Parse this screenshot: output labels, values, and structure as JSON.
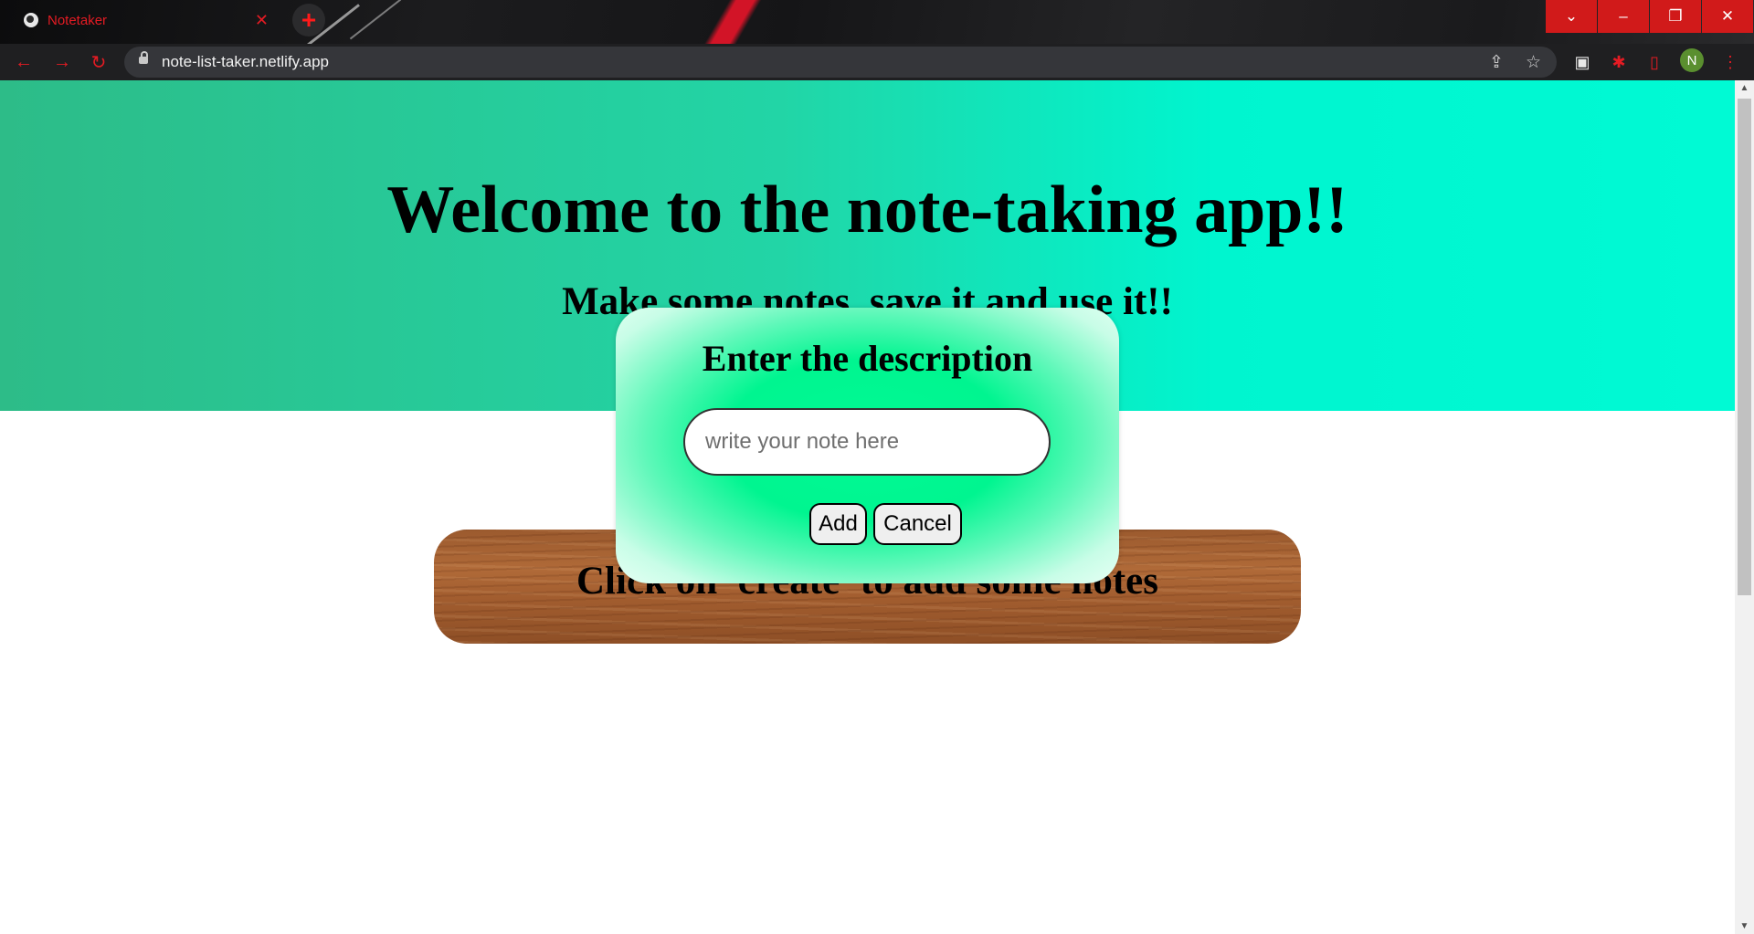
{
  "browser": {
    "tab_title": "Notetaker",
    "tab_close": "✕",
    "new_tab": "+",
    "url": "note-list-taker.netlify.app",
    "profile_initial": "N",
    "window_controls": {
      "tabs_menu": "⌄",
      "minimize": "–",
      "restore": "❐",
      "close": "✕"
    },
    "accent_color": "#e41b23"
  },
  "page": {
    "title": "Welcome to the note-taking app!!",
    "subtitle": "Make some notes, save it and use it!!",
    "empty_message": "Click on 'create' to add some notes"
  },
  "modal": {
    "title": "Enter the description",
    "input_placeholder": "write your note here",
    "input_value": "",
    "add_label": "Add",
    "cancel_label": "Cancel"
  }
}
